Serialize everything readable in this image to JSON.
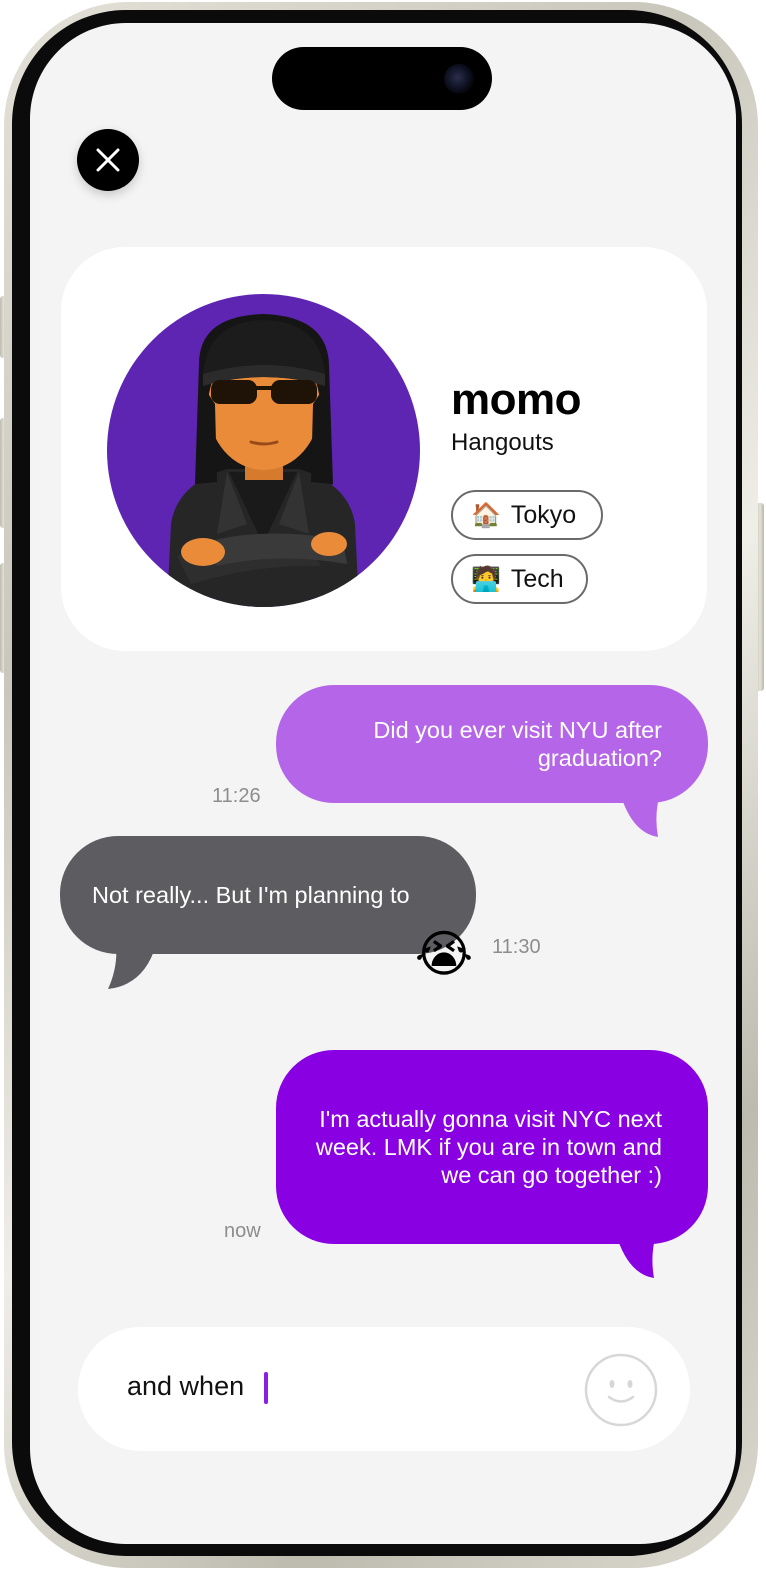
{
  "header": {
    "close_icon": "close-icon"
  },
  "profile": {
    "name": "momo",
    "subtitle": "Hangouts",
    "avatar": "avatar-3d-character",
    "tags": [
      {
        "emoji": "🏠",
        "label": "Tokyo"
      },
      {
        "emoji": "🧑‍💻",
        "label": "Tech"
      }
    ],
    "avatar_bg": "#5e25b3"
  },
  "messages": [
    {
      "from": "me",
      "text": "Did you ever visit NYU after graduation?",
      "time": "11:26",
      "color": "#b566e8"
    },
    {
      "from": "them",
      "text": "Not really... But I'm planning to",
      "time": "11:30",
      "reaction": "😭",
      "color": "#5d5c60"
    },
    {
      "from": "me",
      "text": "I'm actually gonna visit NYC next week. LMK if you are in town and we can go together :)",
      "time": "now",
      "color": "#8900e2"
    }
  ],
  "composer": {
    "value": "and when",
    "emoji_icon": "smiley-icon"
  }
}
